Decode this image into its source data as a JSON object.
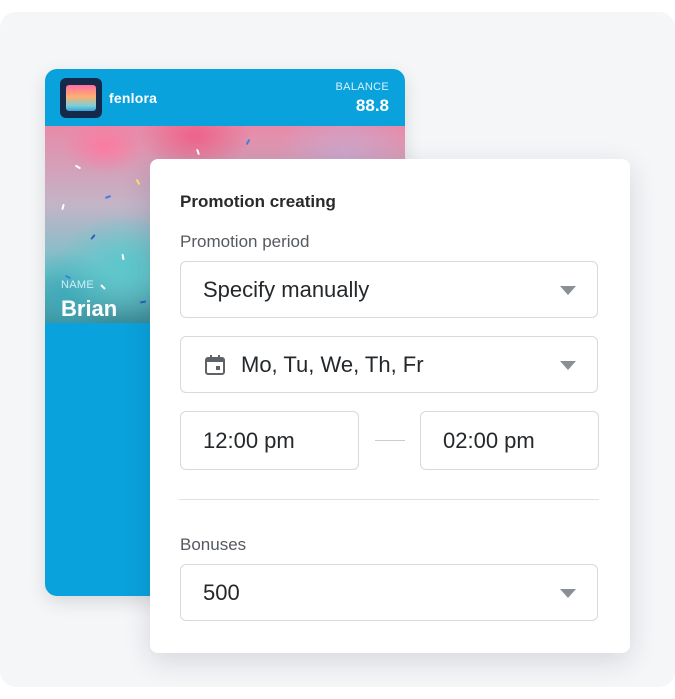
{
  "card": {
    "brand": "fenlora",
    "balance_label": "BALANCE",
    "balance_value": "88.8",
    "name_label": "NAME",
    "name_value": "Brian",
    "color": "#0aa2dc"
  },
  "promotion": {
    "title": "Promotion creating",
    "period_label": "Promotion period",
    "period_value": "Specify manually",
    "days_value": "Mo, Tu, We, Th, Fr",
    "time_start": "12:00 pm",
    "time_end": "02:00 pm",
    "bonuses_label": "Bonuses",
    "bonuses_value": "500"
  },
  "icons": {
    "calendar": "calendar-icon",
    "dropdown": "chevron-down-icon"
  }
}
